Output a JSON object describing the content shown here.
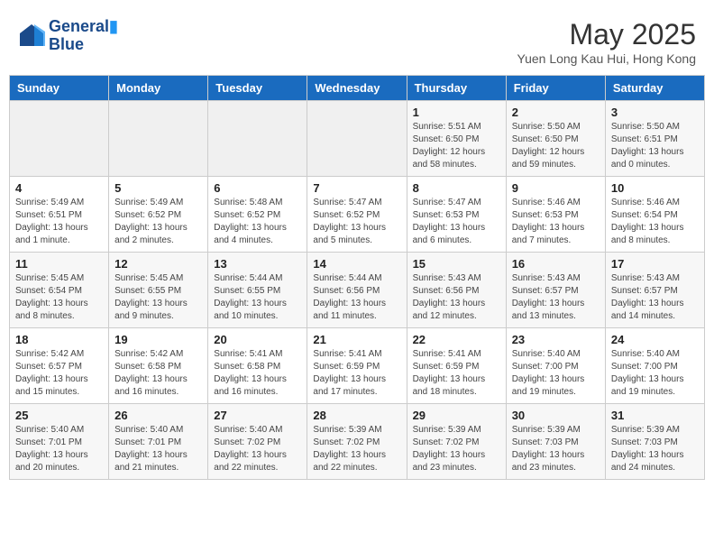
{
  "header": {
    "logo_line1": "General",
    "logo_line2": "Blue",
    "month_title": "May 2025",
    "location": "Yuen Long Kau Hui, Hong Kong"
  },
  "weekdays": [
    "Sunday",
    "Monday",
    "Tuesday",
    "Wednesday",
    "Thursday",
    "Friday",
    "Saturday"
  ],
  "weeks": [
    [
      {
        "day": "",
        "info": ""
      },
      {
        "day": "",
        "info": ""
      },
      {
        "day": "",
        "info": ""
      },
      {
        "day": "",
        "info": ""
      },
      {
        "day": "1",
        "info": "Sunrise: 5:51 AM\nSunset: 6:50 PM\nDaylight: 12 hours\nand 58 minutes."
      },
      {
        "day": "2",
        "info": "Sunrise: 5:50 AM\nSunset: 6:50 PM\nDaylight: 12 hours\nand 59 minutes."
      },
      {
        "day": "3",
        "info": "Sunrise: 5:50 AM\nSunset: 6:51 PM\nDaylight: 13 hours\nand 0 minutes."
      }
    ],
    [
      {
        "day": "4",
        "info": "Sunrise: 5:49 AM\nSunset: 6:51 PM\nDaylight: 13 hours\nand 1 minute."
      },
      {
        "day": "5",
        "info": "Sunrise: 5:49 AM\nSunset: 6:52 PM\nDaylight: 13 hours\nand 2 minutes."
      },
      {
        "day": "6",
        "info": "Sunrise: 5:48 AM\nSunset: 6:52 PM\nDaylight: 13 hours\nand 4 minutes."
      },
      {
        "day": "7",
        "info": "Sunrise: 5:47 AM\nSunset: 6:52 PM\nDaylight: 13 hours\nand 5 minutes."
      },
      {
        "day": "8",
        "info": "Sunrise: 5:47 AM\nSunset: 6:53 PM\nDaylight: 13 hours\nand 6 minutes."
      },
      {
        "day": "9",
        "info": "Sunrise: 5:46 AM\nSunset: 6:53 PM\nDaylight: 13 hours\nand 7 minutes."
      },
      {
        "day": "10",
        "info": "Sunrise: 5:46 AM\nSunset: 6:54 PM\nDaylight: 13 hours\nand 8 minutes."
      }
    ],
    [
      {
        "day": "11",
        "info": "Sunrise: 5:45 AM\nSunset: 6:54 PM\nDaylight: 13 hours\nand 8 minutes."
      },
      {
        "day": "12",
        "info": "Sunrise: 5:45 AM\nSunset: 6:55 PM\nDaylight: 13 hours\nand 9 minutes."
      },
      {
        "day": "13",
        "info": "Sunrise: 5:44 AM\nSunset: 6:55 PM\nDaylight: 13 hours\nand 10 minutes."
      },
      {
        "day": "14",
        "info": "Sunrise: 5:44 AM\nSunset: 6:56 PM\nDaylight: 13 hours\nand 11 minutes."
      },
      {
        "day": "15",
        "info": "Sunrise: 5:43 AM\nSunset: 6:56 PM\nDaylight: 13 hours\nand 12 minutes."
      },
      {
        "day": "16",
        "info": "Sunrise: 5:43 AM\nSunset: 6:57 PM\nDaylight: 13 hours\nand 13 minutes."
      },
      {
        "day": "17",
        "info": "Sunrise: 5:43 AM\nSunset: 6:57 PM\nDaylight: 13 hours\nand 14 minutes."
      }
    ],
    [
      {
        "day": "18",
        "info": "Sunrise: 5:42 AM\nSunset: 6:57 PM\nDaylight: 13 hours\nand 15 minutes."
      },
      {
        "day": "19",
        "info": "Sunrise: 5:42 AM\nSunset: 6:58 PM\nDaylight: 13 hours\nand 16 minutes."
      },
      {
        "day": "20",
        "info": "Sunrise: 5:41 AM\nSunset: 6:58 PM\nDaylight: 13 hours\nand 16 minutes."
      },
      {
        "day": "21",
        "info": "Sunrise: 5:41 AM\nSunset: 6:59 PM\nDaylight: 13 hours\nand 17 minutes."
      },
      {
        "day": "22",
        "info": "Sunrise: 5:41 AM\nSunset: 6:59 PM\nDaylight: 13 hours\nand 18 minutes."
      },
      {
        "day": "23",
        "info": "Sunrise: 5:40 AM\nSunset: 7:00 PM\nDaylight: 13 hours\nand 19 minutes."
      },
      {
        "day": "24",
        "info": "Sunrise: 5:40 AM\nSunset: 7:00 PM\nDaylight: 13 hours\nand 19 minutes."
      }
    ],
    [
      {
        "day": "25",
        "info": "Sunrise: 5:40 AM\nSunset: 7:01 PM\nDaylight: 13 hours\nand 20 minutes."
      },
      {
        "day": "26",
        "info": "Sunrise: 5:40 AM\nSunset: 7:01 PM\nDaylight: 13 hours\nand 21 minutes."
      },
      {
        "day": "27",
        "info": "Sunrise: 5:40 AM\nSunset: 7:02 PM\nDaylight: 13 hours\nand 22 minutes."
      },
      {
        "day": "28",
        "info": "Sunrise: 5:39 AM\nSunset: 7:02 PM\nDaylight: 13 hours\nand 22 minutes."
      },
      {
        "day": "29",
        "info": "Sunrise: 5:39 AM\nSunset: 7:02 PM\nDaylight: 13 hours\nand 23 minutes."
      },
      {
        "day": "30",
        "info": "Sunrise: 5:39 AM\nSunset: 7:03 PM\nDaylight: 13 hours\nand 23 minutes."
      },
      {
        "day": "31",
        "info": "Sunrise: 5:39 AM\nSunset: 7:03 PM\nDaylight: 13 hours\nand 24 minutes."
      }
    ]
  ]
}
